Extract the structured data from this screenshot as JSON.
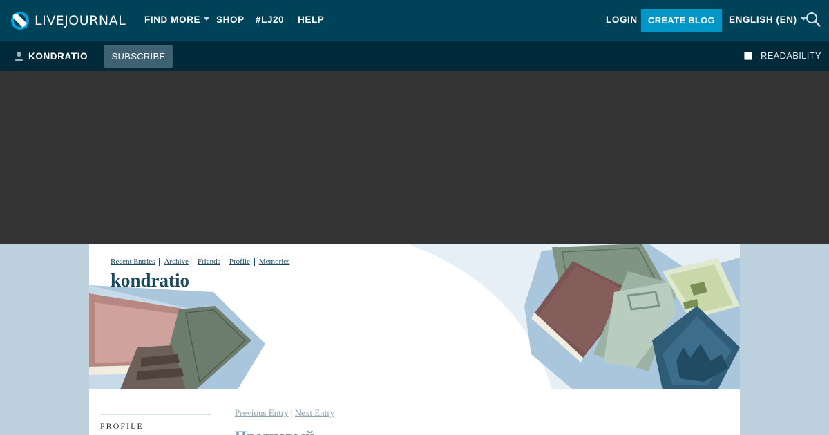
{
  "brand": {
    "name": "LIVEJOURNAL"
  },
  "topnav": {
    "find_more": "FIND MORE",
    "shop": "SHOP",
    "lj20": "#LJ20",
    "help": "HELP",
    "login": "LOGIN",
    "create_blog": "CREATE BLOG",
    "language": "ENGLISH (EN)"
  },
  "subbar": {
    "username": "KONDRATIO",
    "subscribe": "SUBSCRIBE",
    "readability": "READABILITY",
    "readability_checked": false
  },
  "journal": {
    "nav": [
      "Recent Entries",
      "Archive",
      "Friends",
      "Profile",
      "Memories"
    ],
    "title": "kondratio",
    "sidebar_label": "PROFILE",
    "prev_entry": "Previous Entry",
    "separator": "|",
    "next_entry": "Next Entry",
    "entry_title": "Предновый"
  },
  "icons": {
    "logo": "livejournal-pencil-logo",
    "search": "search-icon",
    "user": "user-icon",
    "dropdown": "chevron-down-icon"
  },
  "colors": {
    "topbar": "#004359",
    "subbar": "#002a3a",
    "accent": "#0096c8",
    "ad_area": "#333333",
    "page_bg": "#bcd0de",
    "journal_text": "#1a4a60"
  }
}
